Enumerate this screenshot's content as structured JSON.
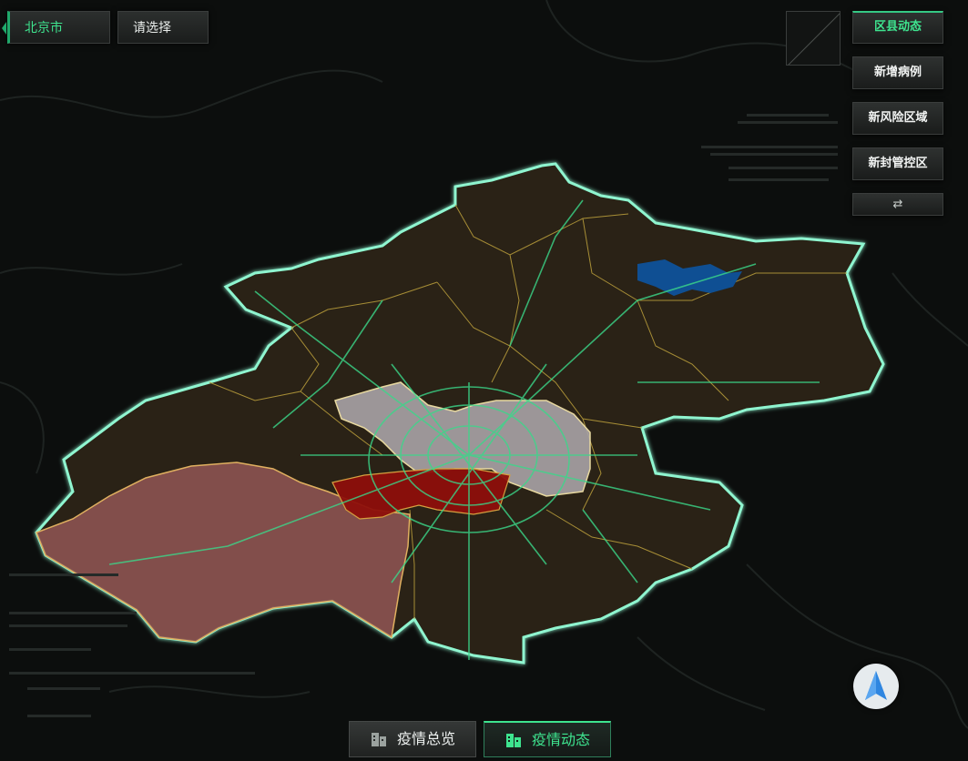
{
  "top_left": {
    "city_label": "北京市",
    "region_placeholder": "请选择"
  },
  "right_panel": {
    "buttons": [
      {
        "label": "区县动态",
        "active": true
      },
      {
        "label": "新增病例",
        "active": false
      },
      {
        "label": "新风险区域",
        "active": false
      },
      {
        "label": "新封管控区",
        "active": false
      }
    ],
    "swap_symbol": "⇄"
  },
  "bottom_tabs": [
    {
      "label": "疫情总览",
      "active": false,
      "icon": "building-icon"
    },
    {
      "label": "疫情动态",
      "active": true,
      "icon": "building-icon"
    }
  ],
  "map": {
    "colors": {
      "outline": "#8ff5d0",
      "district_fill": "#2a2413",
      "district_border": "#b59a3a",
      "highlight_light": "#a9a3a6",
      "highlight_pink": "#8a5350",
      "highlight_red": "#8d0f0b",
      "reservoir": "#0f4f93",
      "roads": "#3bd88a",
      "accent": "#3ee48f"
    },
    "layers": [
      "district-outline",
      "road-network",
      "highlighted-districts",
      "reservoir"
    ]
  },
  "compass": {
    "icon": "north-arrow-icon"
  }
}
